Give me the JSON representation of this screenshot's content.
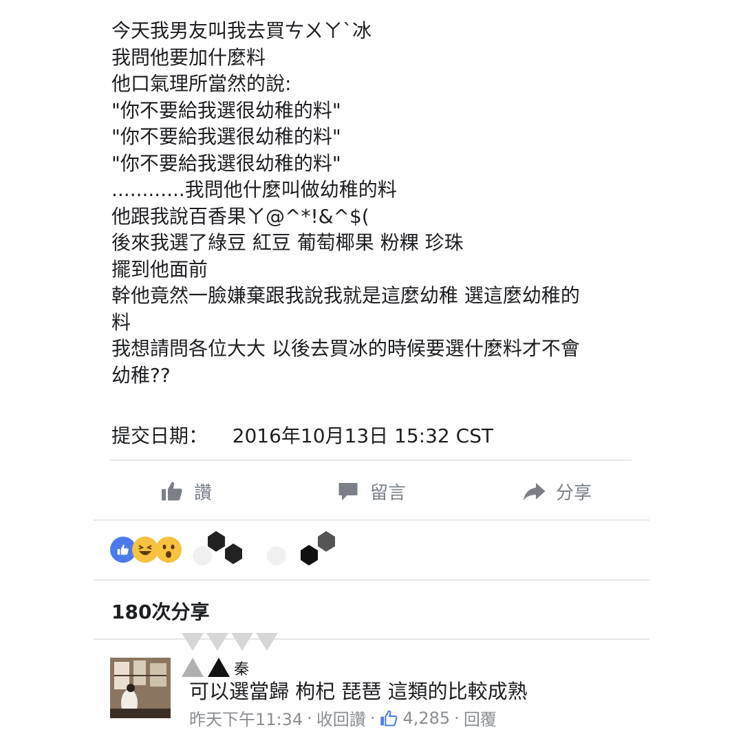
{
  "post": {
    "lines": [
      "今天我男友叫我去買ㄘㄨㄚ`冰",
      "我問他要加什麼料",
      "他口氣理所當然的說:",
      "\"你不要給我選很幼稚的料\"",
      "\"你不要給我選很幼稚的料\"",
      "\"你不要給我選很幼稚的料\"",
      "............我問他什麼叫做幼稚的料",
      "他跟我說百香果ㄚ@^*!&^$(",
      "後來我選了綠豆 紅豆 葡萄椰果 粉粿 珍珠",
      "擺到他面前",
      "幹他竟然一臉嫌棄跟我說我就是這麼幼稚 選這麼幼稚的",
      "料",
      "我想請問各位大大 以後去買冰的時候要選什麼料才不會",
      "幼稚??"
    ],
    "submit_label": "提交日期：",
    "submit_date": "2016年10月13日 15:32 CST"
  },
  "actions": {
    "like_label": "讚",
    "comment_label": "留言",
    "share_label": "分享"
  },
  "reactions": {
    "icons": [
      "like-reaction-icon",
      "haha-reaction-icon",
      "wow-reaction-icon"
    ],
    "colors": {
      "like": "#4b7bec",
      "haha": "#f7c23f",
      "wow": "#f7c23f"
    }
  },
  "shares": {
    "count_text": "180次分享"
  },
  "comment": {
    "author_fragment": "秦",
    "text": "可以選當歸 枸杞 琵琶 這類的比較成熟",
    "time": "昨天下午11:34",
    "retract_like": "收回讚",
    "likes": "4,285",
    "reply": "回覆"
  },
  "colors": {
    "text": "#1c1e21",
    "muted": "#7a7f88",
    "divider": "#e6e6e6",
    "accent": "#4b7bec"
  }
}
